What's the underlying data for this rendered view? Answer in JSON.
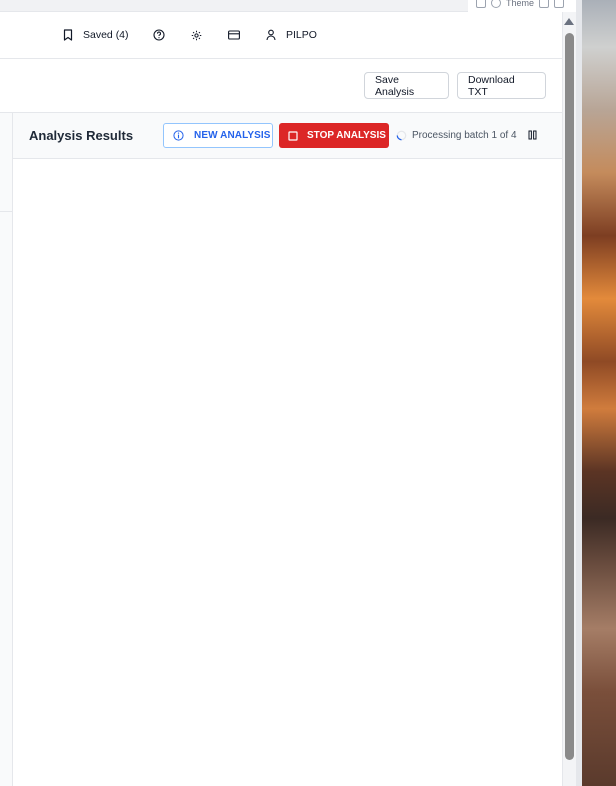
{
  "browser": {
    "theme_label": "Theme"
  },
  "navbar": {
    "saved_label": "Saved (4)",
    "help_icon": "question-circle-icon",
    "settings_icon": "gear-icon",
    "billing_icon": "credit-card-icon",
    "user_label": "PILPO"
  },
  "actions": {
    "save_label": "Save Analysis",
    "download_label": "Download TXT"
  },
  "results": {
    "title": "Analysis Results",
    "new_label": "NEW ANALYSIS",
    "stop_label": "STOP ANALYSIS",
    "status": "Processing batch 1 of 4"
  },
  "colors": {
    "accent_blue": "#2563eb",
    "stop_red": "#dc2626",
    "border": "#e5e7eb"
  }
}
